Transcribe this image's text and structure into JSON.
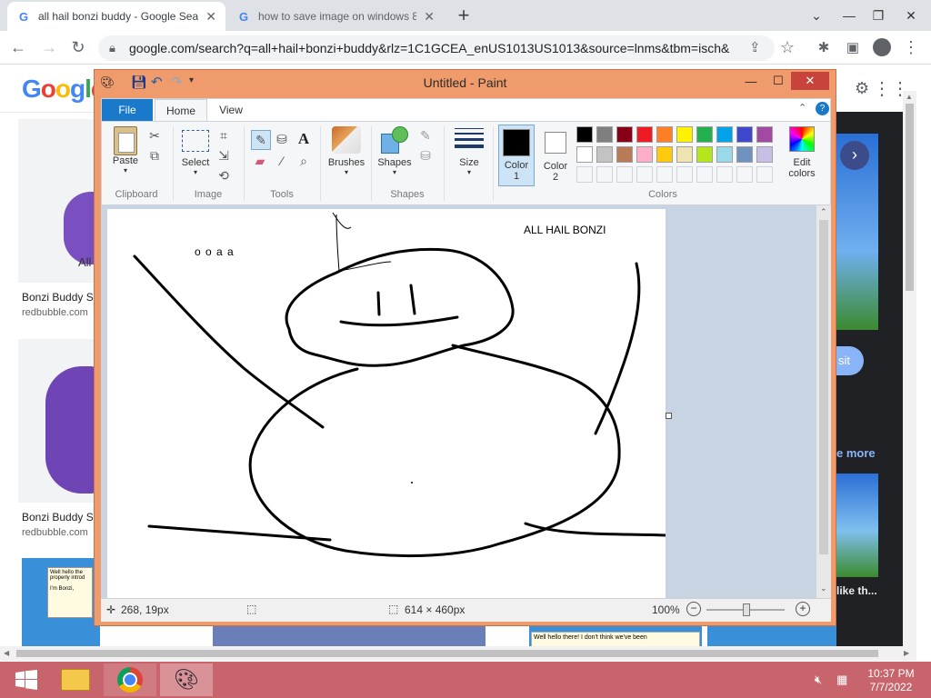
{
  "browser": {
    "tabs": [
      {
        "title": "all hail bonzi buddy - Google Sea",
        "active": true
      },
      {
        "title": "how to save image on windows 8"
      }
    ],
    "new_tab": "+",
    "url": "google.com/search?q=all+hail+bonzi+buddy&rlz=1C1GCEA_enUS1013US1013&source=lnms&tbm=isch&..."
  },
  "google": {
    "logo": "Google",
    "results": [
      {
        "caption": "Bonzi Buddy S",
        "source": "redbubble.com",
        "thumb_text": "All"
      },
      {
        "caption": "Bonzi Buddy S",
        "source": "redbubble.com"
      }
    ],
    "bubble_text_1": "Well hello there! I don't think we've been properly introduced.",
    "bubble_text_1_visible": "Well hello the properly introd",
    "bubble_text_1b": "I'm Bonzi,",
    "bubble_text_2": "Well hello there! I don't think we've been",
    "right_visit": "sit",
    "right_more": "e more",
    "right_like": "like th..."
  },
  "paint": {
    "title": "Untitled - Paint",
    "tabs": {
      "file": "File",
      "home": "Home",
      "view": "View"
    },
    "groups": {
      "clipboard": "Clipboard",
      "image": "Image",
      "tools": "Tools",
      "shapes": "Shapes",
      "colors": "Colors"
    },
    "buttons": {
      "paste": "Paste",
      "select": "Select",
      "brushes": "Brushes",
      "shapes": "Shapes",
      "size": "Size",
      "color1": "Color",
      "color1_num": "1",
      "color2": "Color",
      "color2_num": "2",
      "edit_colors_1": "Edit",
      "edit_colors_2": "colors"
    },
    "palette_row1": [
      "#000000",
      "#7f7f7f",
      "#880015",
      "#ed1c24",
      "#ff7f27",
      "#fff200",
      "#22b14c",
      "#00a2e8",
      "#3f48cc",
      "#a349a4"
    ],
    "palette_row2": [
      "#ffffff",
      "#c3c3c3",
      "#b97a57",
      "#ffaec9",
      "#ffc90e",
      "#efe4b0",
      "#b5e61d",
      "#99d9ea",
      "#7092be",
      "#c8bfe7"
    ],
    "canvas_text": {
      "left": "o o a a",
      "right": "ALL HAIL BONZI"
    },
    "status": {
      "cursor": "268, 19px",
      "size": "614 × 460px",
      "zoom": "100%"
    }
  },
  "taskbar": {
    "time": "10:37 PM",
    "date": "7/7/2022"
  }
}
